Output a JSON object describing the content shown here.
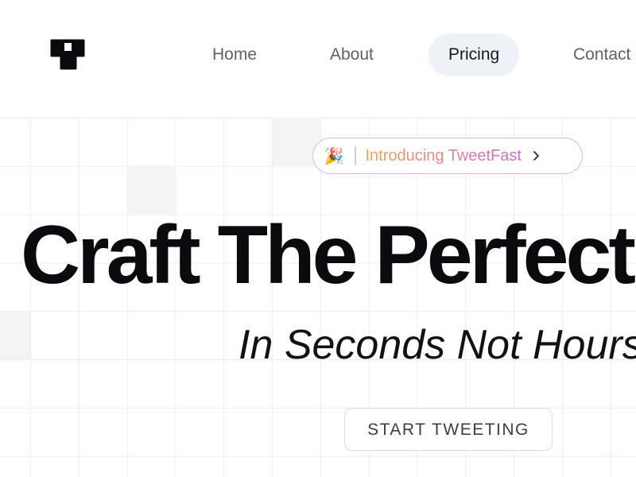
{
  "nav": {
    "items": [
      {
        "label": "Home",
        "active": false
      },
      {
        "label": "About",
        "active": false
      },
      {
        "label": "Pricing",
        "active": true
      },
      {
        "label": "Contact",
        "active": false
      }
    ]
  },
  "logo": {
    "icon": "brand-logo-icon"
  },
  "badge": {
    "emoji": "🎉",
    "text": "Introducing TweetFast",
    "chevron_icon": "chevron-right-icon"
  },
  "hero": {
    "title": "Craft The Perfect",
    "subtitle": "In Seconds Not Hours"
  },
  "cta": {
    "label": "START TWEETING"
  },
  "colors": {
    "text_primary": "#0b0b0f",
    "nav_text": "#5b6170",
    "nav_active_bg": "#eef1f6",
    "badge_gradient_start": "#f2a14d",
    "badge_gradient_end": "#c96bd8",
    "grid_line": "#ececec"
  }
}
